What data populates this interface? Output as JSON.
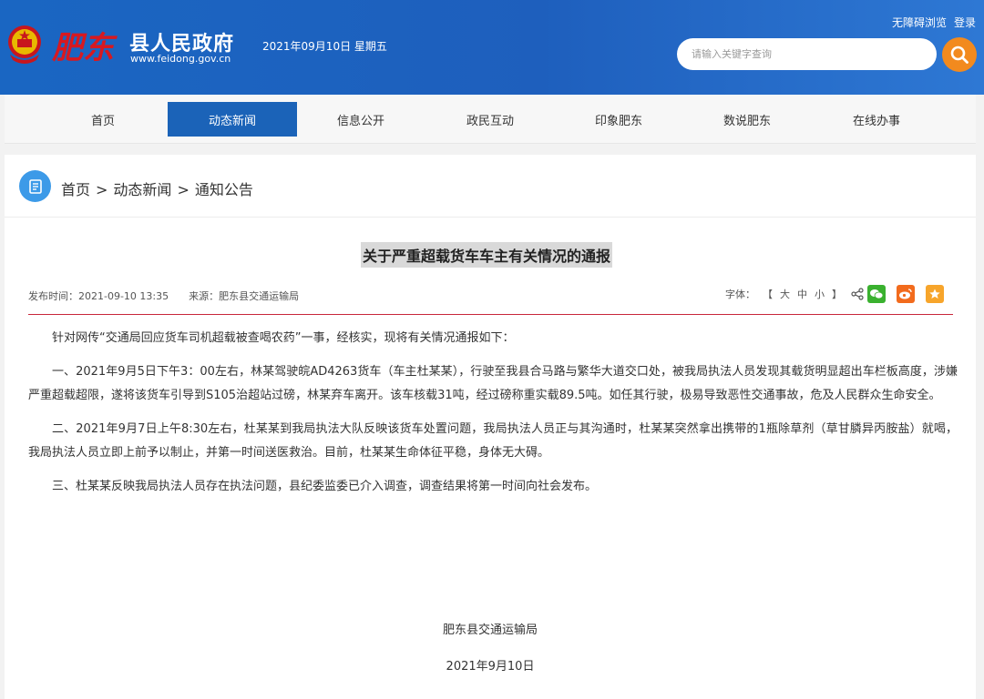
{
  "header": {
    "site_name": "县人民政府",
    "site_url": "www.feidong.gov.cn",
    "logo_text": "肥东",
    "date": "2021年09月10日 星期五",
    "top_links": [
      "无障碍浏览",
      "登录"
    ],
    "search_placeholder": "请输入关键字查询",
    "search_icon": "search-icon"
  },
  "nav": {
    "items": [
      "首页",
      "动态新闻",
      "信息公开",
      "政民互动",
      "印象肥东",
      "数说肥东",
      "在线办事"
    ],
    "active": "动态新闻"
  },
  "breadcrumb": [
    "首页",
    "动态新闻",
    "通知公告"
  ],
  "breadcrumb_separator": ">",
  "article": {
    "title": "关于严重超载货车车主有关情况的通报",
    "published": "发布时间：2021-09-10 13:35",
    "source": "来源：肥东县交通运输局",
    "font_label": "字体：",
    "font_open": "【",
    "font_sizes": [
      "大",
      "中",
      "小"
    ],
    "font_close": "】",
    "share_icons": [
      "wechat-icon",
      "weibo-icon",
      "favorite-icon"
    ],
    "paragraphs": [
      "针对网传“交通局回应货车司机超载被查喝农药”一事，经核实，现将有关情况通报如下：",
      "一、2021年9月5日下午3：00左右，林某驾驶皖AD4263货车（车主杜某某），行驶至我县合马路与繁华大道交口处，被我局执法人员发现其载货明显超出车栏板高度，涉嫌严重超载超限，遂将该货车引导到S105治超站过磅，林某弃车离开。该车核载31吨，经过磅称重实载89.5吨。如任其行驶，极易导致恶性交通事故，危及人民群众生命安全。",
      "二、2021年9月7日上午8:30左右，杜某某到我局执法大队反映该货车处置问题，我局执法人员正与其沟通时，杜某某突然拿出携带的1瓶除草剂（草甘膦异丙胺盐）就喝，我局执法人员立即上前予以制止，并第一时间送医救治。目前，杜某某生命体征平稳，身体无大碍。",
      "三、杜某某反映我局执法人员存在执法问题，县纪委监委已介入调查，调查结果将第一时间向社会发布。"
    ],
    "signature_org": "肥东县交通运输局",
    "signature_date": "2021年9月10日"
  },
  "colors": {
    "header_blue": "#1e5fbd",
    "nav_active": "#1b63b8",
    "search_orange": "#f28a1e",
    "rule_red": "#c8273a",
    "wechat_green": "#3ab12f",
    "weibo_orange": "#f26b1d",
    "favorite_orange": "#f7a52b"
  }
}
